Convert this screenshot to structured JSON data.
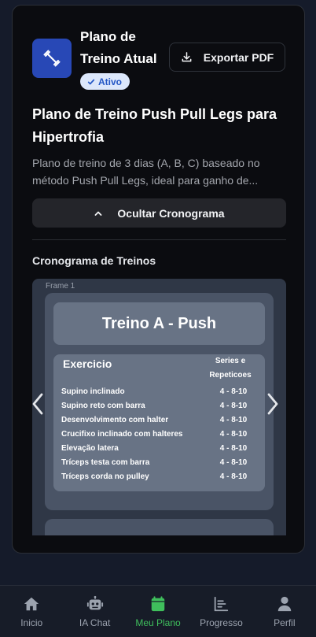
{
  "plan": {
    "title": "Plano de Treino Atual",
    "status_badge": "Ativo",
    "export_label": "Exportar PDF",
    "name": "Plano de Treino Push Pull Legs para Hipertrofia",
    "description_line1": "Plano de treino de 3 dias (A, B, C) baseado no",
    "description_line2": "método Push Pull Legs, ideal para ganho de...",
    "toggle_label": "Ocultar Cronograma"
  },
  "schedule": {
    "section_title": "Cronograma de Treinos",
    "frame_label": "Frame 1",
    "workout_title": "Treino A - Push",
    "col_exercise": "Exercicio",
    "col_sets_line1": "Series e",
    "col_sets_line2": "Repeticoes",
    "exercises": [
      {
        "name": "Supino inclinado",
        "reps": "4 - 8-10"
      },
      {
        "name": "Supino reto com barra",
        "reps": "4 - 8-10"
      },
      {
        "name": "Desenvolvimento com halter",
        "reps": "4 - 8-10"
      },
      {
        "name": "Crucifixo inclinado com halteres",
        "reps": "4 - 8-10"
      },
      {
        "name": "Elevação latera",
        "reps": "4 - 8-10"
      },
      {
        "name": "Tríceps testa com barra",
        "reps": "4 - 8-10"
      },
      {
        "name": "Tríceps corda no pulley",
        "reps": "4 - 8-10"
      }
    ]
  },
  "nav": {
    "items": [
      {
        "label": "Inicio",
        "icon": "home-icon"
      },
      {
        "label": "IA Chat",
        "icon": "robot-icon"
      },
      {
        "label": "Meu Plano",
        "icon": "calendar-icon",
        "active": true
      },
      {
        "label": "Progresso",
        "icon": "chart-icon"
      },
      {
        "label": "Perfil",
        "icon": "user-icon"
      }
    ]
  },
  "colors": {
    "accent": "#3fbf5c",
    "brand_blue": "#2848b6",
    "badge_text": "#2457c5"
  }
}
